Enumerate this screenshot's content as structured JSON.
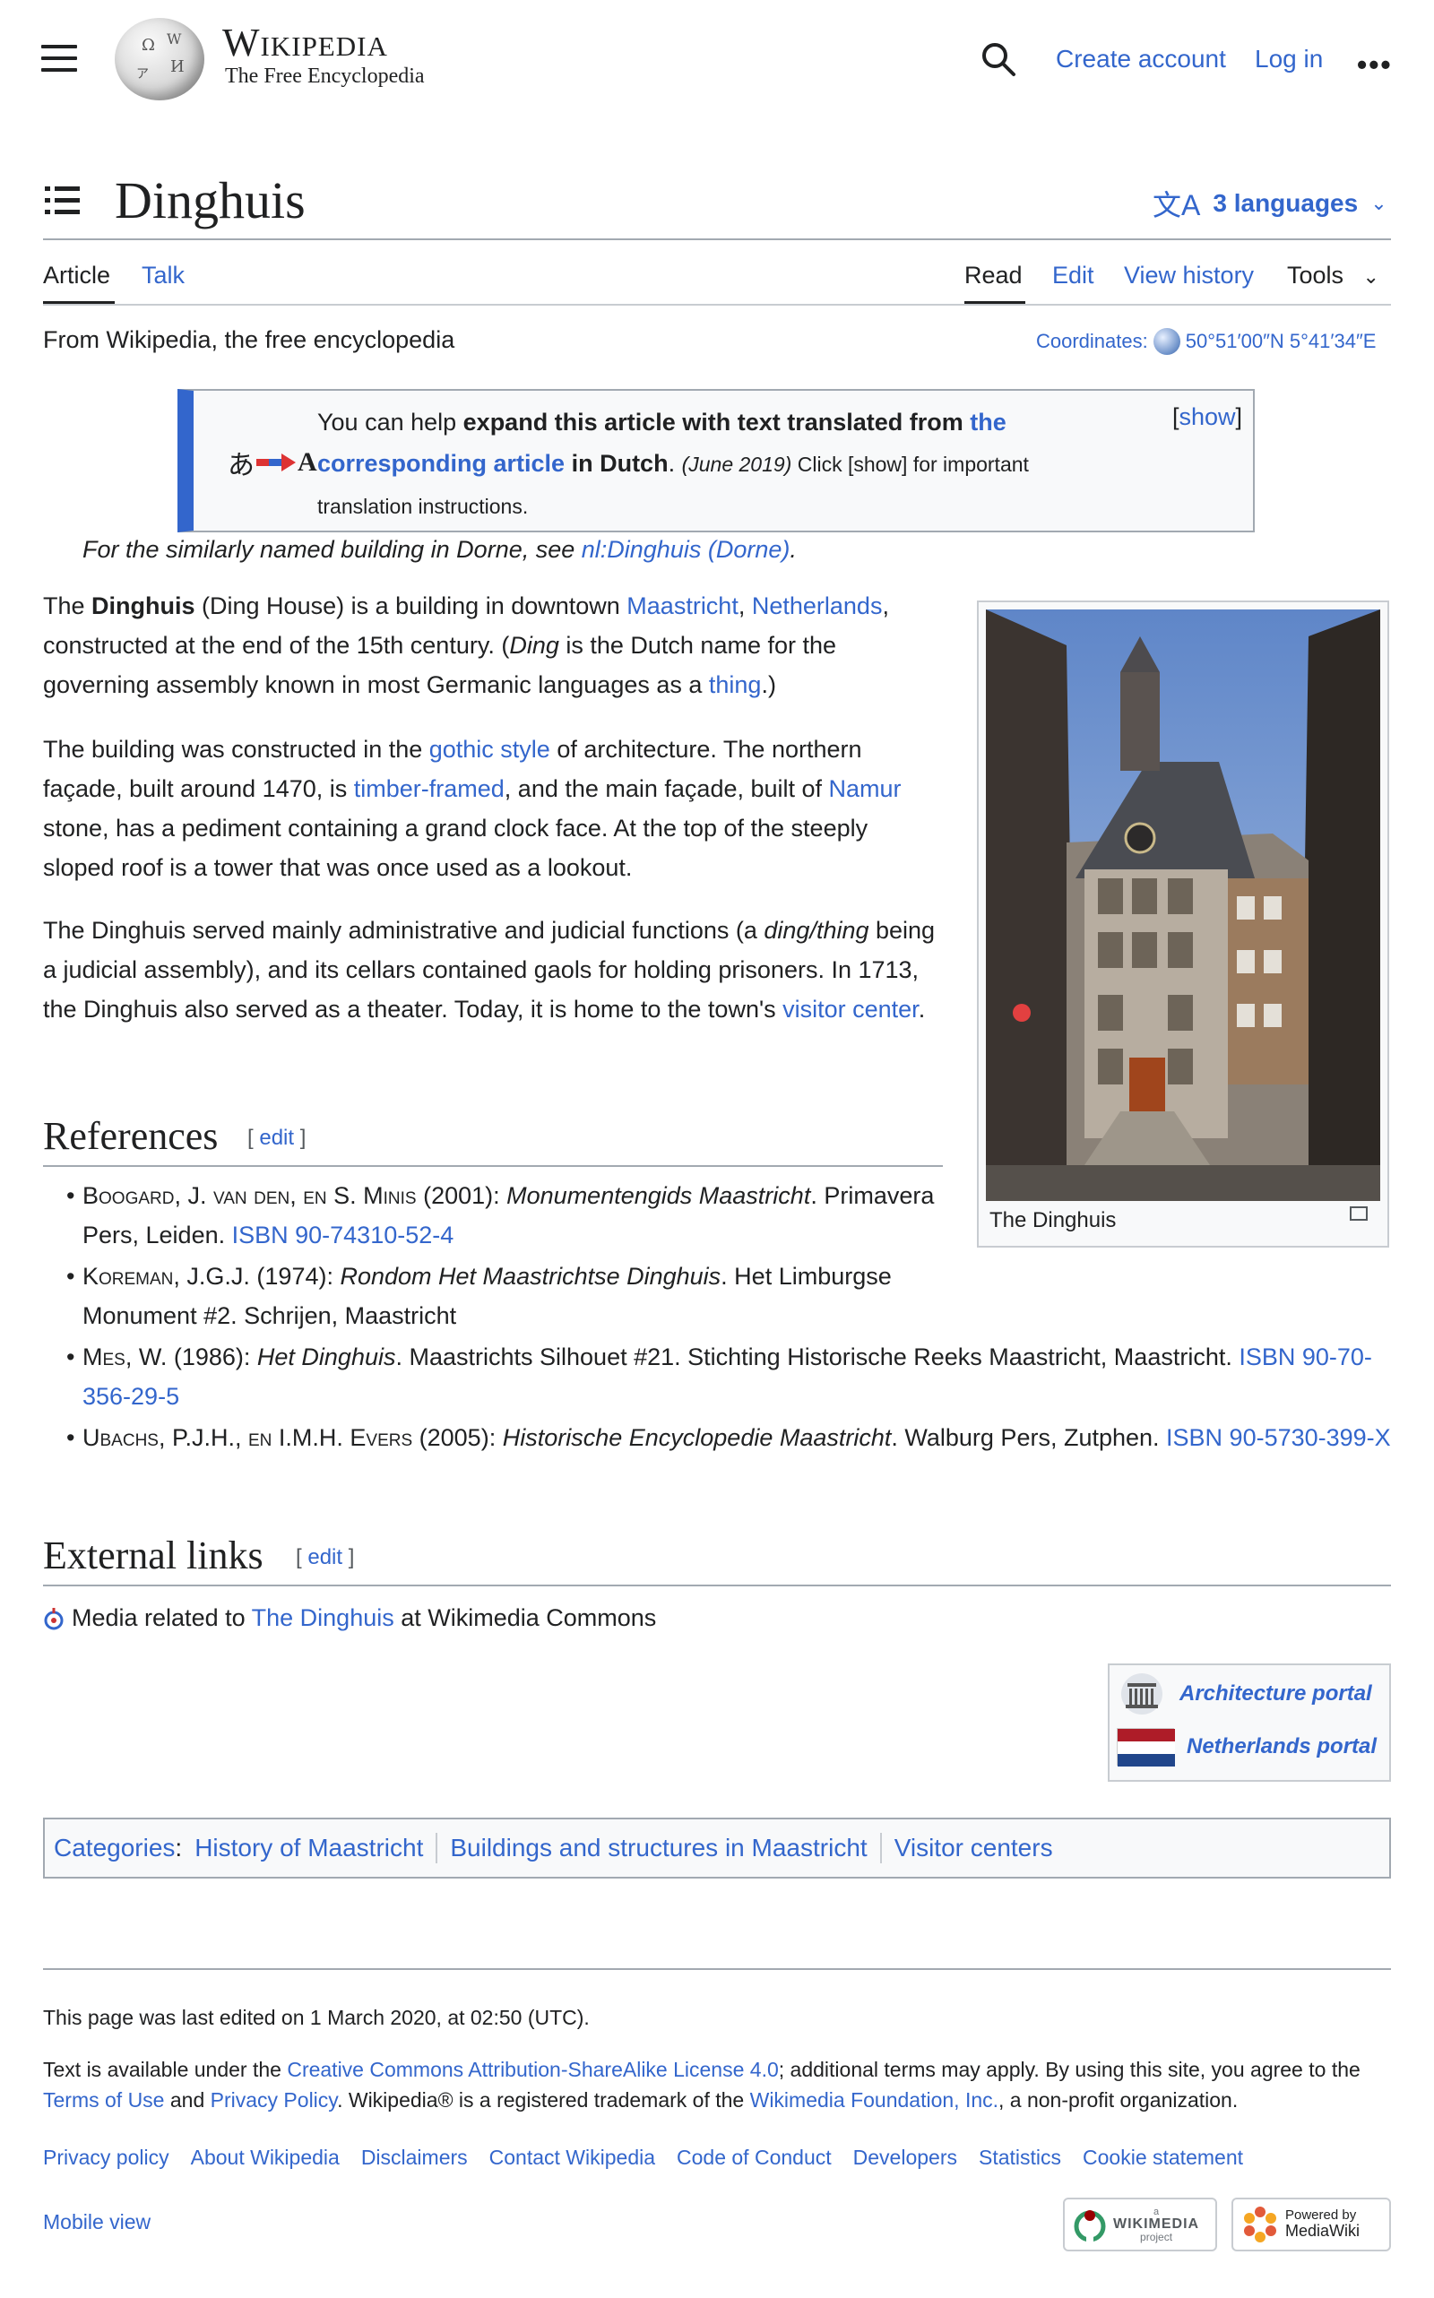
{
  "header": {
    "wordmark": "Wikipedia",
    "tagline": "The Free Encyclopedia",
    "create_account": "Create account",
    "log_in": "Log in",
    "more": "•••"
  },
  "page": {
    "title": "Dinghuis",
    "languages": "3 languages",
    "tabs": {
      "article": "Article",
      "talk": "Talk",
      "read": "Read",
      "edit": "Edit",
      "history": "View history",
      "tools": "Tools"
    },
    "from_wiki": "From Wikipedia, the free encyclopedia",
    "coords_label": "Coordinates:",
    "coords_value": "50°51′00″N 5°41′34″E"
  },
  "ambox": {
    "t1": "You can help ",
    "t2": "expand this article with text translated from ",
    "link": "the corresponding article",
    "t3": " in Dutch",
    "t4": ". ",
    "date": "(June 2019)",
    "t5": " Click [show] for important translation instructions.",
    "show": "show",
    "icon_left": "あ",
    "icon_right": "A"
  },
  "hatnote": {
    "text": "For the similarly named building in Dorne, see ",
    "link": "nl:Dinghuis (Dorne)",
    "end": "."
  },
  "p1": {
    "a": "The ",
    "b": "Dinghuis",
    "c": " (Ding House) is a building in downtown ",
    "l1": "Maastricht",
    "d": ", ",
    "l2": "Netherlands",
    "e": ", constructed at the end of the 15th century. (",
    "f": "Ding",
    "g": " is the Dutch name for the governing assembly known in most Germanic languages as a ",
    "l3": "thing",
    "h": ".)"
  },
  "p2": {
    "a": "The building was constructed in the ",
    "l1": "gothic style",
    "b": " of architecture. The northern façade, built around 1470, is ",
    "l2": "timber-framed",
    "c": ", and the main façade, built of ",
    "l3": "Namur",
    "d": " stone, has a pediment containing a grand clock face. At the top of the steeply sloped roof is a tower that was once used as a lookout."
  },
  "p3": {
    "a": "The  Dinghuis served mainly administrative and judicial functions (a ",
    "b": "ding/thing",
    "c": " being a judicial assembly), and its cellars contained gaols for holding prisoners. In 1713, the Dinghuis also served as a theater. Today, it is home to the town's ",
    "l1": "visitor center",
    "d": "."
  },
  "thumb": {
    "caption": "The Dinghuis"
  },
  "references": {
    "heading": "References",
    "edit": "edit",
    "items": [
      {
        "a": "Boogard, J. van den, en S. Minis",
        "b": " (2001): ",
        "c": "Monumentengids Maastricht",
        "d": ". Primavera Pers, Leiden. ",
        "isbn": "ISBN 90-74310-52-4"
      },
      {
        "a": "Koreman, J.G.J.",
        "b": " (1974): ",
        "c": "Rondom Het Maastrichtse Dinghuis",
        "d": ". Het Limburgse Monument #2. Schrijen, Maastricht",
        "isbn": ""
      },
      {
        "a": "Mes, W.",
        "b": " (1986): ",
        "c": "Het Dinghuis",
        "d": ". Maastrichts Silhouet #21. Stichting Historische Reeks Maastricht, Maastricht. ",
        "isbn": "ISBN 90-70-356-29-5"
      },
      {
        "a": "Ubachs, P.J.H., en I.M.H. Evers",
        "b": " (2005): ",
        "c": "Historische Encyclopedie Maastricht",
        "d": ". Walburg Pers, Zutphen. ",
        "isbn": "ISBN 90-5730-399-X"
      }
    ]
  },
  "external": {
    "heading": "External links",
    "edit": "edit",
    "a": "Media related to ",
    "link": "The Dinghuis",
    "b": " at Wikimedia Commons"
  },
  "portals": {
    "architecture": "Architecture portal",
    "netherlands": "Netherlands portal"
  },
  "categories": {
    "label": "Categories",
    "colon": ":",
    "items": [
      "History of Maastricht",
      "Buildings and structures in Maastricht",
      "Visitor centers"
    ]
  },
  "footer": {
    "last_edited": "This page was last edited on 1 March 2020, at 02:50 (UTC).",
    "lic_a": "Text is available under the ",
    "lic_link": "Creative Commons Attribution-ShareAlike License 4.0",
    "lic_b": "; additional terms may apply. By using this site, you agree to the ",
    "terms": "Terms of Use",
    "and": " and ",
    "privacy": "Privacy Policy",
    "lic_c": ". Wikipedia® is a registered trademark of the ",
    "wmf": "Wikimedia Foundation, Inc.",
    "lic_d": ", a non-profit organization.",
    "links": [
      "Privacy policy",
      "About Wikipedia",
      "Disclaimers",
      "Contact Wikipedia",
      "Code of Conduct",
      "Developers",
      "Statistics",
      "Cookie statement"
    ],
    "mobile_view": "Mobile view",
    "wm_top": "a",
    "wm_name": "WIKIMEDIA",
    "wm_sub": "project",
    "mw_top": "Powered by",
    "mw_name": "MediaWiki"
  },
  "colors": {
    "link": "#3366cc",
    "text": "#202122",
    "ambox_bar": "#3366cc",
    "border": "#a2a9b1"
  }
}
